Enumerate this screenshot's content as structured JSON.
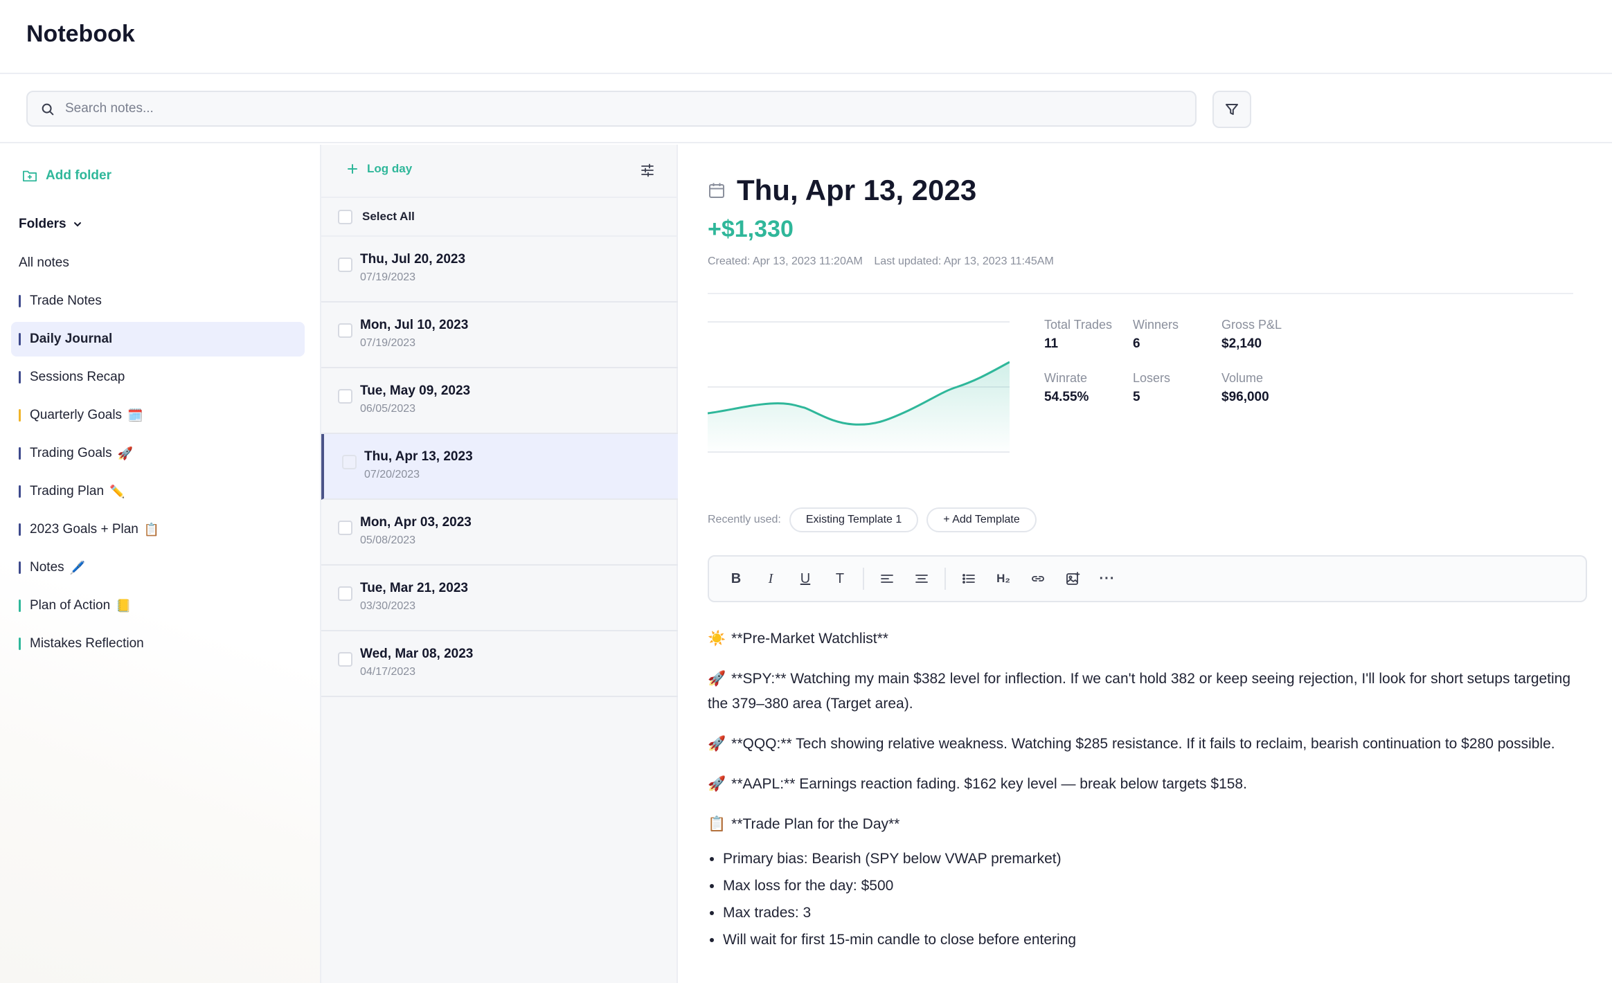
{
  "app": {
    "title": "Notebook"
  },
  "search": {
    "placeholder": "Search notes..."
  },
  "sidebar": {
    "add_folder_label": "Add folder",
    "folders_label": "Folders",
    "items": [
      {
        "label": "All notes",
        "bar_color": "",
        "emoji": ""
      },
      {
        "label": "Trade Notes",
        "bar_color": "#3e4a8c",
        "emoji": ""
      },
      {
        "label": "Daily Journal",
        "bar_color": "#3e4a8c",
        "emoji": "",
        "active": true
      },
      {
        "label": "Sessions Recap",
        "bar_color": "#3e4a8c",
        "emoji": ""
      },
      {
        "label": "Quarterly Goals",
        "bar_color": "#f0b429",
        "emoji": "🗓️"
      },
      {
        "label": "Trading Goals",
        "bar_color": "#3e4a8c",
        "emoji": "🚀"
      },
      {
        "label": "Trading Plan",
        "bar_color": "#3e4a8c",
        "emoji": "✏️"
      },
      {
        "label": "2023 Goals + Plan",
        "bar_color": "#3e4a8c",
        "emoji": "📋"
      },
      {
        "label": "Notes",
        "bar_color": "#3e4a8c",
        "emoji": "🖊️"
      },
      {
        "label": "Plan of Action",
        "bar_color": "#2fb79a",
        "emoji": "📒"
      },
      {
        "label": "Mistakes Reflection",
        "bar_color": "#2fb79a",
        "emoji": ""
      }
    ]
  },
  "day_list": {
    "log_day_label": "Log day",
    "select_all_label": "Select All",
    "rows": [
      {
        "title": "Thu, Jul 20, 2023",
        "sub": "07/19/2023"
      },
      {
        "title": "Mon, Jul 10, 2023",
        "sub": "07/19/2023"
      },
      {
        "title": "Tue, May 09, 2023",
        "sub": "06/05/2023"
      },
      {
        "title": "Thu, Apr 13, 2023",
        "sub": "07/20/2023",
        "active": true
      },
      {
        "title": "Mon, Apr 03, 2023",
        "sub": "05/08/2023"
      },
      {
        "title": "Tue, Mar 21, 2023",
        "sub": "03/30/2023"
      },
      {
        "title": "Wed, Mar 08, 2023",
        "sub": "04/17/2023"
      }
    ]
  },
  "detail": {
    "date_title": "Thu, Apr 13, 2023",
    "pnl": "+$1,330",
    "created": "Created: Apr 13, 2023 11:20AM",
    "updated": "Last updated: Apr 13, 2023 11:45AM",
    "stats": {
      "total_trades_label": "Total Trades",
      "total_trades": "11",
      "winners_label": "Winners",
      "winners": "6",
      "gross_pnl_label": "Gross P&L",
      "gross_pnl": "$2,140",
      "winrate_label": "Winrate",
      "winrate": "54.55%",
      "losers_label": "Losers",
      "losers": "5",
      "volume_label": "Volume",
      "volume": "$96,000"
    },
    "chart_color": "#2fb79a",
    "templates": {
      "label": "Recently used:",
      "existing": "Existing Template 1",
      "add": "+ Add Template"
    },
    "toolbar": {
      "bold": "B",
      "italic": "I",
      "underline": "U",
      "text": "T",
      "heading": "H₂",
      "more": "···"
    },
    "content": {
      "p1": "**Pre-Market Watchlist**",
      "p2": "**SPY:** Watching my main $382 level for inflection. If we can't hold 382 or keep seeing rejection, I'll look for short setups targeting the 379–380 area (Target area).",
      "p3": "**QQQ:** Tech showing relative weakness. Watching $285 resistance. If it fails to reclaim, bearish continuation to $280 possible.",
      "p4": "**AAPL:** Earnings reaction fading. $162 key level — break below targets $158.",
      "p5": "**Trade Plan for the Day**",
      "bullets": [
        "Primary bias: Bearish (SPY below VWAP premarket)",
        "Max loss for the day: $500",
        "Max trades: 3",
        "Will wait for first 15-min candle to close before entering"
      ],
      "emoji_sun": "☀️",
      "emoji_rocket": "🚀",
      "emoji_clipboard": "📋"
    }
  }
}
